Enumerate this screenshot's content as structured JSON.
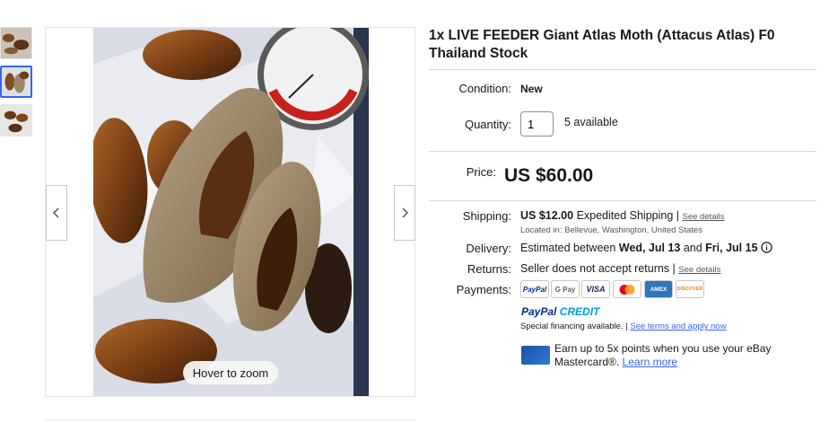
{
  "listing": {
    "title": "1x LIVE FEEDER Giant Atlas Moth (Attacus Atlas) F0 Thailand Stock"
  },
  "gallery": {
    "hover_label": "Hover to zoom",
    "thumbnails": [
      "thumb-1",
      "thumb-2",
      "thumb-3"
    ],
    "active_index": 1
  },
  "condition": {
    "label": "Condition:",
    "value": "New"
  },
  "quantity": {
    "label": "Quantity:",
    "value": "1",
    "available": "5 available"
  },
  "price": {
    "label": "Price:",
    "value": "US $60.00"
  },
  "shipping": {
    "label": "Shipping:",
    "amount": "US $12.00",
    "method": "Expedited Shipping |",
    "details_link": "See details",
    "location": "Located in: Bellevue, Washington, United States"
  },
  "delivery": {
    "label": "Delivery:",
    "prefix": "Estimated between",
    "start": "Wed, Jul 13",
    "and": "and",
    "end": "Fri, Jul 15"
  },
  "returns": {
    "label": "Returns:",
    "text": "Seller does not accept returns |",
    "details_link": "See details"
  },
  "payments": {
    "label": "Payments:",
    "logos": [
      {
        "name": "PayPal",
        "color": "#003087"
      },
      {
        "name": "G Pay",
        "color": "#5f6368"
      },
      {
        "name": "VISA",
        "color": "#1a1f71"
      },
      {
        "name": "mastercard",
        "color": "#eb001b"
      },
      {
        "name": "AMEX",
        "color": "#2e77bb"
      },
      {
        "name": "DISCOVER",
        "color": "#f48120"
      }
    ],
    "paypal_credit_a": "PayPal",
    "paypal_credit_b": " CREDIT",
    "financing_text": "Special financing available. |",
    "financing_link": "See terms and apply now",
    "rewards_text": "Earn up to 5x points when you use your eBay Mastercard®.",
    "rewards_link": "Learn more"
  },
  "colors": {
    "accent_blue": "#3665f3",
    "text": "#191919"
  }
}
